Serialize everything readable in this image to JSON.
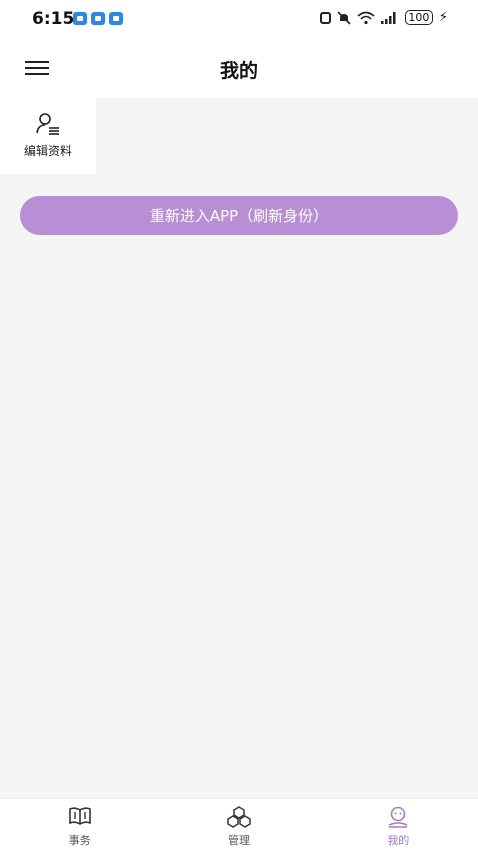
{
  "status_bar": {
    "time": "6:15",
    "battery": "100",
    "charging_glyph": "⚡",
    "icons": [
      "app-notification-icon",
      "app-notification-icon",
      "app-notification-icon",
      "nfc-icon",
      "mute-icon",
      "wifi-icon",
      "signal-icon",
      "battery-icon"
    ]
  },
  "header": {
    "title": "我的",
    "menu_icon": "hamburger-menu-icon"
  },
  "side_panel": {
    "edit_profile_label": "编辑资料",
    "edit_profile_icon": "user-edit-icon"
  },
  "actions": {
    "refresh_label": "重新进入APP（刷新身份）"
  },
  "tab_bar": {
    "tabs": [
      {
        "label": "事务",
        "icon": "book-icon",
        "active": false
      },
      {
        "label": "管理",
        "icon": "cubes-icon",
        "active": false
      },
      {
        "label": "我的",
        "icon": "profile-icon",
        "active": true
      }
    ]
  },
  "colors": {
    "accent": "#b88fd4",
    "active_tab": "#a67bc6",
    "background": "#f5f5f5"
  }
}
